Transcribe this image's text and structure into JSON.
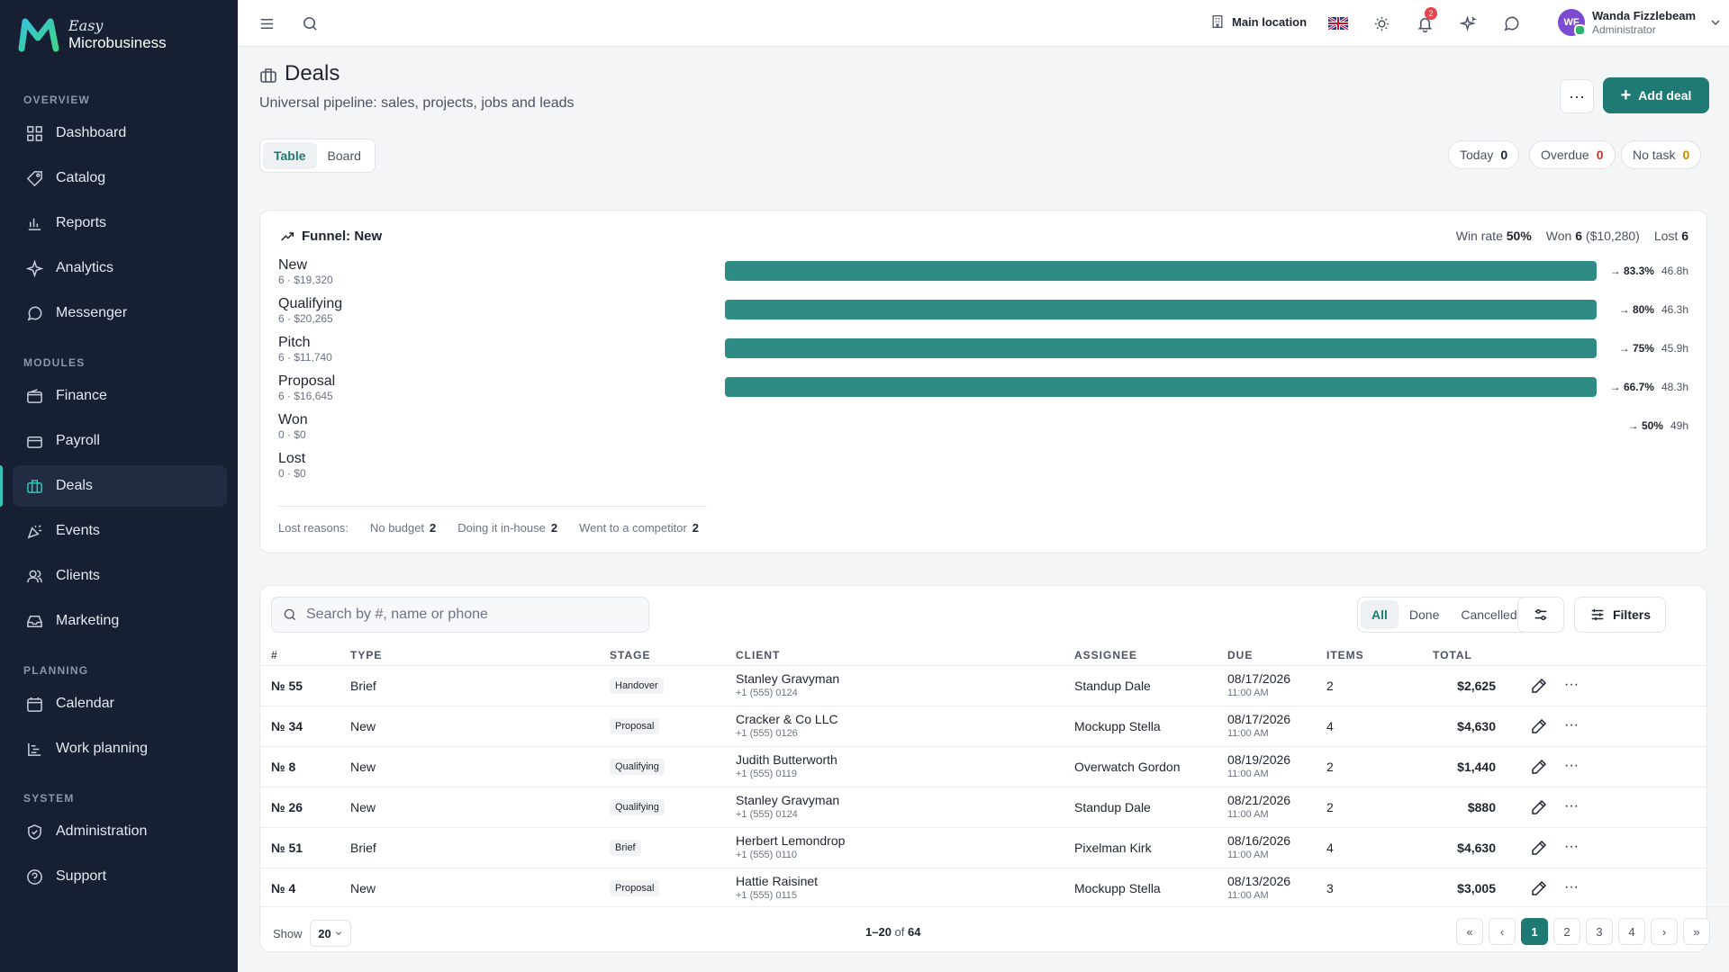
{
  "brand": {
    "easy": "Easy",
    "name": "Microbusiness",
    "colors": {
      "accent": "#1f7a73",
      "teal": "#36c3b5",
      "sidebar": "#172033"
    }
  },
  "sidebar": {
    "sections": [
      {
        "label": "OVERVIEW",
        "items": [
          {
            "label": "Dashboard",
            "icon": "grid-icon"
          },
          {
            "label": "Catalog",
            "icon": "tag-icon"
          },
          {
            "label": "Reports",
            "icon": "bar-chart-icon"
          },
          {
            "label": "Analytics",
            "icon": "sparkle-icon"
          },
          {
            "label": "Messenger",
            "icon": "chat-icon"
          }
        ]
      },
      {
        "label": "MODULES",
        "items": [
          {
            "label": "Finance",
            "icon": "wallet-icon"
          },
          {
            "label": "Payroll",
            "icon": "payroll-icon"
          },
          {
            "label": "Deals",
            "icon": "briefcase-icon",
            "active": true
          },
          {
            "label": "Events",
            "icon": "party-icon"
          },
          {
            "label": "Clients",
            "icon": "users-icon"
          },
          {
            "label": "Marketing",
            "icon": "inbox-icon"
          }
        ]
      },
      {
        "label": "PLANNING",
        "items": [
          {
            "label": "Calendar",
            "icon": "calendar-icon"
          },
          {
            "label": "Work planning",
            "icon": "gantt-icon"
          }
        ]
      },
      {
        "label": "SYSTEM",
        "items": [
          {
            "label": "Administration",
            "icon": "shield-icon"
          },
          {
            "label": "Support",
            "icon": "help-icon"
          }
        ]
      }
    ]
  },
  "topbar": {
    "location": "Main location",
    "notifications": "2",
    "user": {
      "initials": "WF",
      "name": "Wanda Fizzlebeam",
      "role": "Administrator"
    }
  },
  "page": {
    "title": "Deals",
    "subtitle": "Universal pipeline: sales, projects, jobs and leads",
    "more": "···",
    "add": "Add deal",
    "views": [
      "Table",
      "Board"
    ],
    "chips": [
      {
        "label": "Today",
        "count": "0",
        "color": "#1e2430"
      },
      {
        "label": "Overdue",
        "count": "0",
        "color": "#c0392b"
      },
      {
        "label": "No task",
        "count": "0",
        "color": "#c98a00"
      }
    ]
  },
  "funnel": {
    "title": "Funnel: New",
    "win_rate_label": "Win rate",
    "win_rate": "50%",
    "won_label": "Won",
    "won": "6",
    "won_amount": "($10,280)",
    "lost_label": "Lost",
    "lost": "6",
    "stages": [
      {
        "name": "New",
        "sub": "6 · $19,320",
        "fill": 1,
        "conv": "→ 83.3%",
        "time": "46.8h"
      },
      {
        "name": "Qualifying",
        "sub": "6 · $20,265",
        "fill": 1,
        "conv": "→ 80%",
        "time": "46.3h"
      },
      {
        "name": "Pitch",
        "sub": "6 · $11,740",
        "fill": 1,
        "conv": "→ 75%",
        "time": "45.9h"
      },
      {
        "name": "Proposal",
        "sub": "6 · $16,645",
        "fill": 1,
        "conv": "→ 66.7%",
        "time": "48.3h"
      },
      {
        "name": "Won",
        "sub": "0 · $0",
        "fill": 0,
        "conv": "→ 50%",
        "time": "49h"
      },
      {
        "name": "Lost",
        "sub": "0 · $0",
        "fill": 0,
        "conv": "",
        "time": ""
      }
    ],
    "lost_reasons_label": "Lost reasons:",
    "lost_reasons": [
      {
        "label": "No budget",
        "count": "2"
      },
      {
        "label": "Doing it in-house",
        "count": "2"
      },
      {
        "label": "Went to a competitor",
        "count": "2"
      }
    ]
  },
  "table": {
    "search_placeholder": "Search by #, name or phone",
    "status_filters": [
      "All",
      "Done",
      "Cancelled"
    ],
    "filters_label": "Filters",
    "columns": [
      "#",
      "TYPE",
      "STAGE",
      "CLIENT",
      "ASSIGNEE",
      "DUE",
      "ITEMS",
      "TOTAL"
    ],
    "rows": [
      {
        "num": "№ 55",
        "type": "Brief",
        "stage": "Handover",
        "client": "Stanley Gravyman",
        "phone": "+1 (555) 0124",
        "assignee": "Standup Dale",
        "due": "08/17/2026",
        "time": "11:00 AM",
        "items": "2",
        "total": "$2,625"
      },
      {
        "num": "№ 34",
        "type": "New",
        "stage": "Proposal",
        "client": "Cracker & Co LLC",
        "phone": "+1 (555) 0126",
        "assignee": "Mockupp Stella",
        "due": "08/17/2026",
        "time": "11:00 AM",
        "items": "4",
        "total": "$4,630"
      },
      {
        "num": "№ 8",
        "type": "New",
        "stage": "Qualifying",
        "client": "Judith Butterworth",
        "phone": "+1 (555) 0119",
        "assignee": "Overwatch Gordon",
        "due": "08/19/2026",
        "time": "11:00 AM",
        "items": "2",
        "total": "$1,440"
      },
      {
        "num": "№ 26",
        "type": "New",
        "stage": "Qualifying",
        "client": "Stanley Gravyman",
        "phone": "+1 (555) 0124",
        "assignee": "Standup Dale",
        "due": "08/21/2026",
        "time": "11:00 AM",
        "items": "2",
        "total": "$880"
      },
      {
        "num": "№ 51",
        "type": "Brief",
        "stage": "Brief",
        "client": "Herbert Lemondrop",
        "phone": "+1 (555) 0110",
        "assignee": "Pixelman Kirk",
        "due": "08/16/2026",
        "time": "11:00 AM",
        "items": "4",
        "total": "$4,630"
      },
      {
        "num": "№ 4",
        "type": "New",
        "stage": "Proposal",
        "client": "Hattie Raisinet",
        "phone": "+1 (555) 0115",
        "assignee": "Mockupp Stella",
        "due": "08/13/2026",
        "time": "11:00 AM",
        "items": "3",
        "total": "$3,005"
      }
    ],
    "show_label": "Show",
    "page_size": "20",
    "range": "1–20",
    "of": "of",
    "total_count": "64",
    "pages": [
      "1",
      "2",
      "3",
      "4"
    ]
  }
}
